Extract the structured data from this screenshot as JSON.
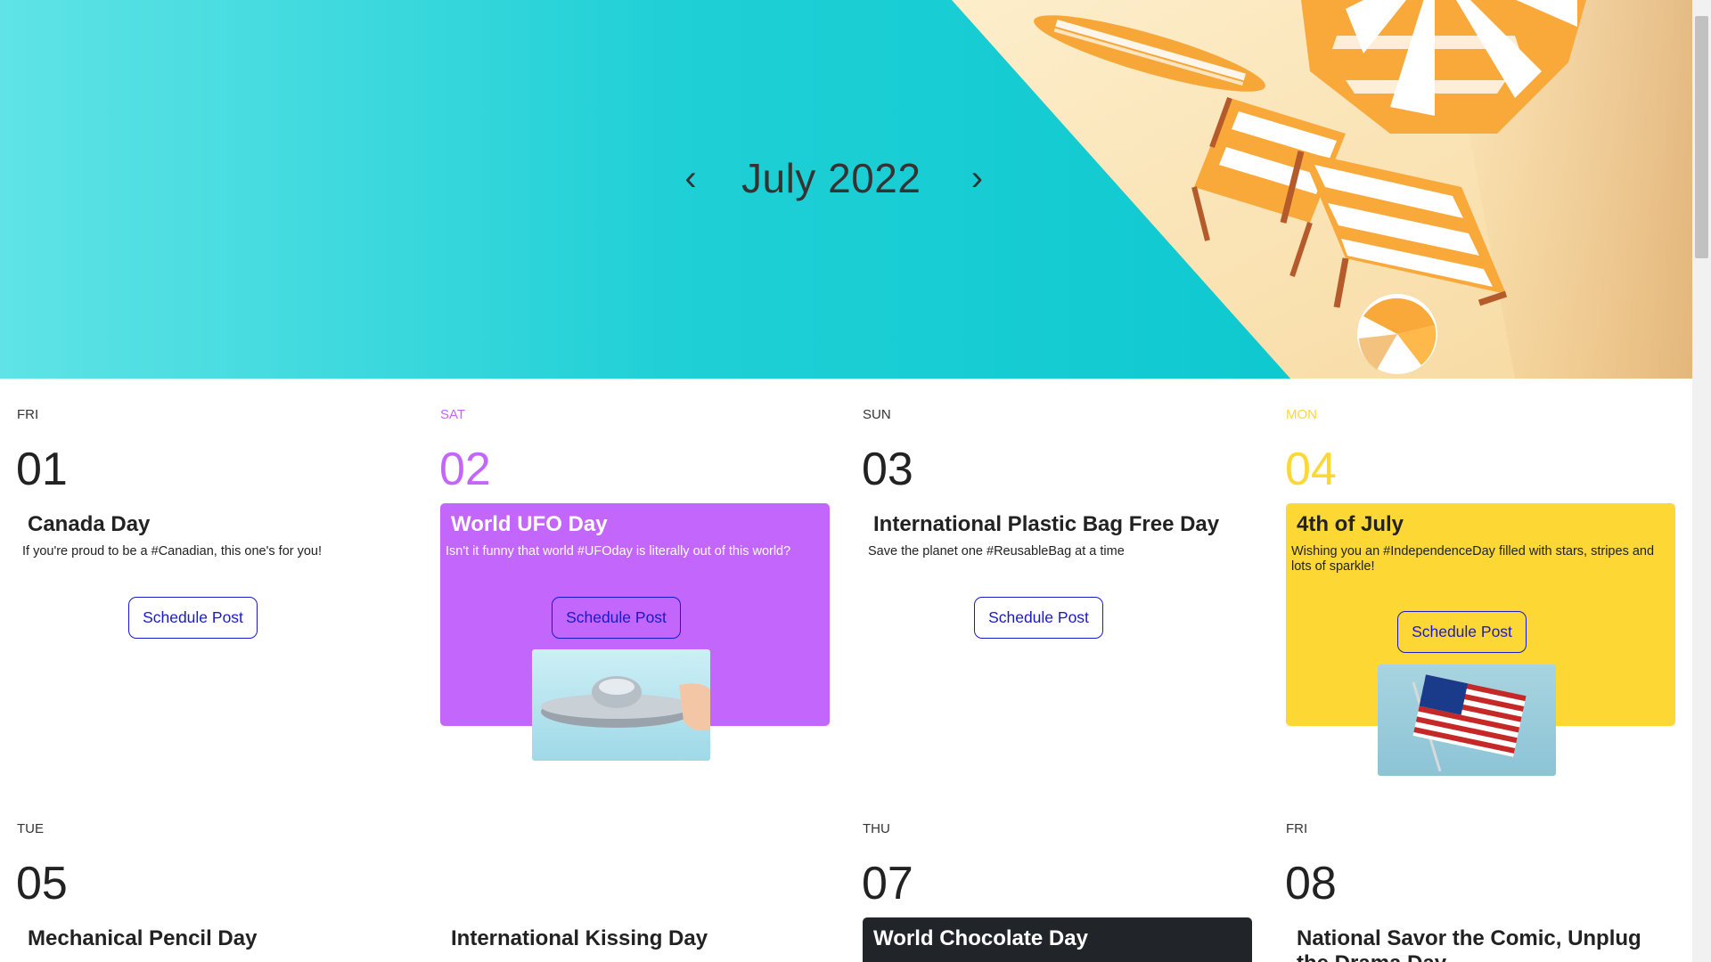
{
  "header": {
    "month_title": "July 2022",
    "prev_icon": "chevron-left-icon",
    "next_icon": "chevron-right-icon",
    "prev_glyph": "‹",
    "next_glyph": "›"
  },
  "colors": {
    "teal": "#04c4cc",
    "purple": "#c366fc",
    "yellow": "#fdd835",
    "dark": "#212529",
    "button_blue": "#1a1ac8"
  },
  "days": [
    {
      "weekday": "FRI",
      "day": "01",
      "title": "Canada Day",
      "desc": "If you're proud to be a #Canadian, this one's for you!",
      "button": "Schedule Post"
    },
    {
      "weekday": "SAT",
      "day": "02",
      "title": "World UFO Day",
      "desc": "Isn't it funny that world #UFOday is literally out of this world?",
      "button": "Schedule Post"
    },
    {
      "weekday": "SUN",
      "day": "03",
      "title": "International Plastic Bag Free Day",
      "desc": "Save the planet one #ReusableBag at a time",
      "button": "Schedule Post"
    },
    {
      "weekday": "MON",
      "day": "04",
      "title": "4th of July",
      "desc": "Wishing you an #IndependenceDay filled with stars, stripes and lots of sparkle!",
      "button": "Schedule Post"
    },
    {
      "weekday": "TUE",
      "day": "05",
      "title": "Mechanical Pencil Day"
    },
    {
      "weekday": "",
      "day": "",
      "title": "International Kissing Day"
    },
    {
      "weekday": "THU",
      "day": "07",
      "title": "World Chocolate Day"
    },
    {
      "weekday": "FRI",
      "day": "08",
      "title": "National Savor the Comic, Unplug the Drama Day"
    }
  ]
}
